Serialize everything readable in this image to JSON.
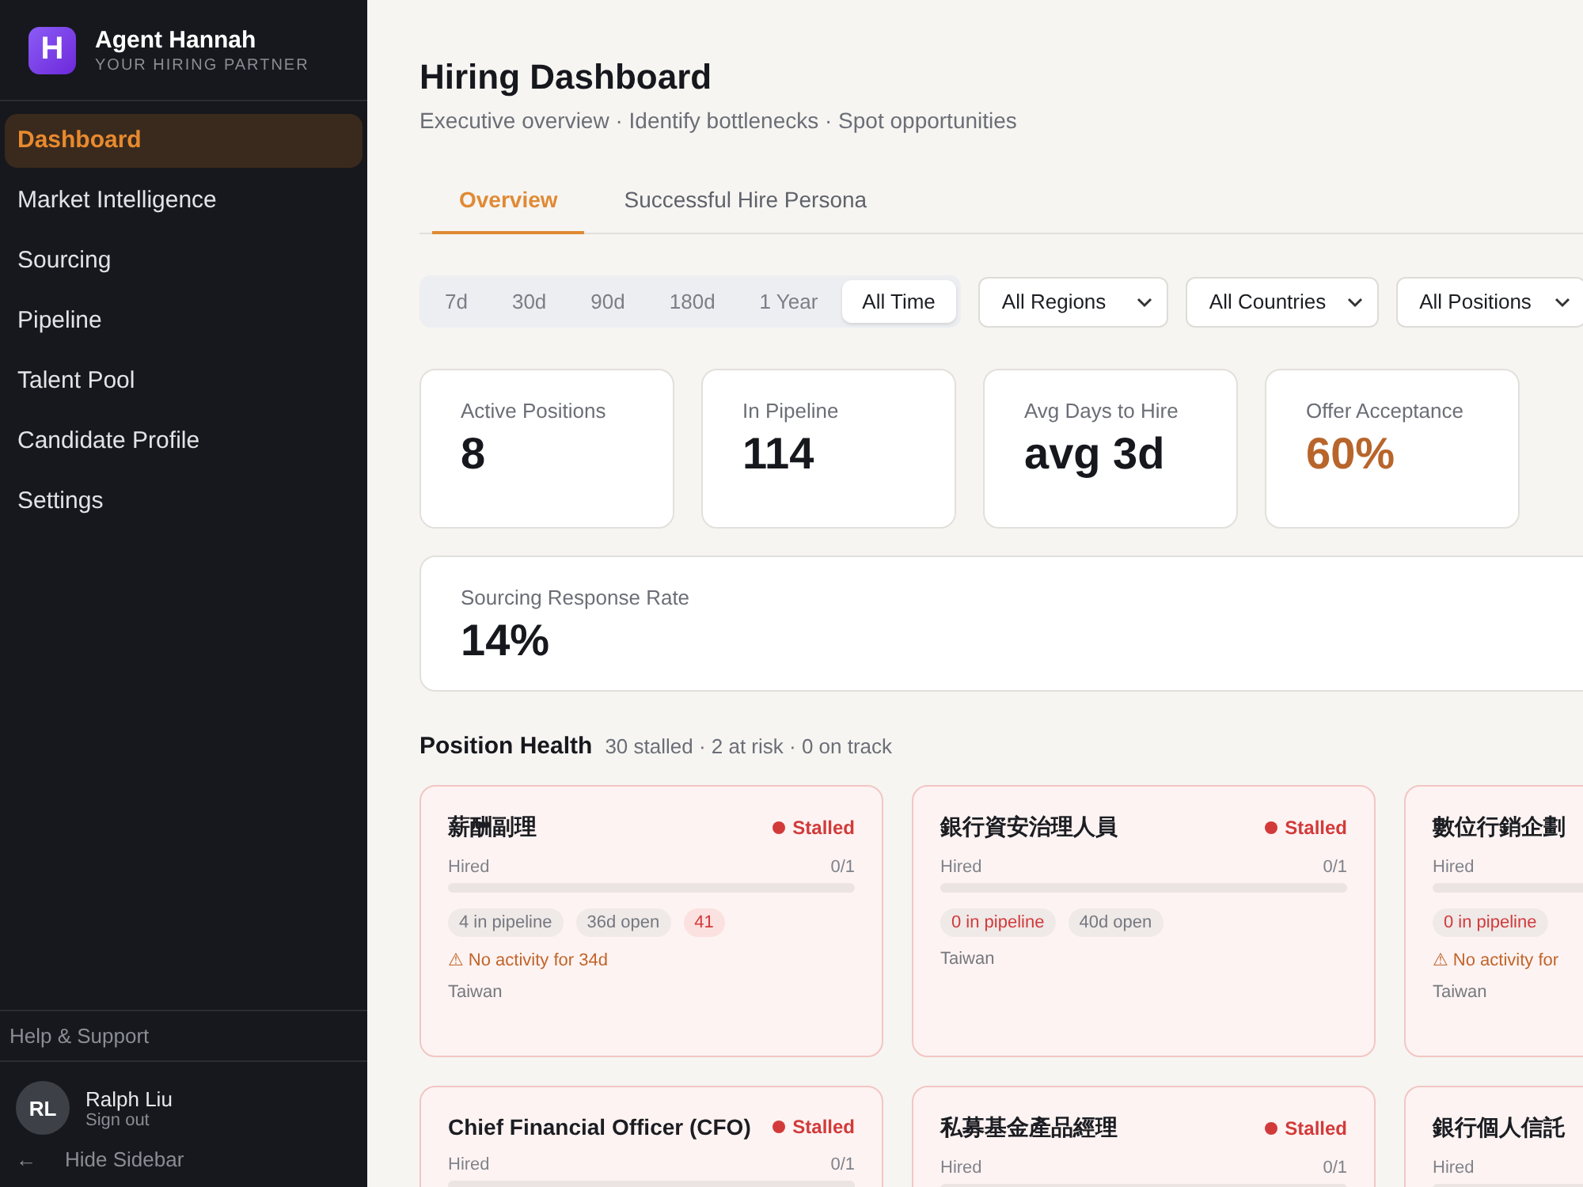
{
  "brand": {
    "logo": "H",
    "name": "Agent Hannah",
    "tagline": "YOUR HIRING PARTNER"
  },
  "nav": [
    {
      "label": "Dashboard",
      "selected": true
    },
    {
      "label": "Market Intelligence",
      "selected": false
    },
    {
      "label": "Sourcing",
      "selected": false
    },
    {
      "label": "Pipeline",
      "selected": false
    },
    {
      "label": "Talent Pool",
      "selected": false
    },
    {
      "label": "Candidate Profile",
      "selected": false
    },
    {
      "label": "Settings",
      "selected": false
    }
  ],
  "help": "Help & Support",
  "user": {
    "initials": "RL",
    "name": "Ralph Liu",
    "action": "Sign out"
  },
  "hide_sidebar": {
    "icon": "←",
    "label": "Hide Sidebar"
  },
  "page": {
    "title": "Hiring Dashboard",
    "subtitle": "Executive overview · Identify bottlenecks · Spot opportunities"
  },
  "tabs": [
    {
      "label": "Overview",
      "selected": true
    },
    {
      "label": "Successful Hire Persona",
      "selected": false
    }
  ],
  "periods": [
    {
      "label": "7d",
      "selected": false
    },
    {
      "label": "30d",
      "selected": false
    },
    {
      "label": "90d",
      "selected": false
    },
    {
      "label": "180d",
      "selected": false
    },
    {
      "label": "1 Year",
      "selected": false
    },
    {
      "label": "All Time",
      "selected": true
    }
  ],
  "filters": [
    {
      "value": "All Regions"
    },
    {
      "value": "All Countries"
    },
    {
      "value": "All Positions"
    }
  ],
  "stats": [
    {
      "label": "Active Positions",
      "value": "8",
      "highlight": false
    },
    {
      "label": "In Pipeline",
      "value": "114",
      "highlight": false
    },
    {
      "label": "Avg Days to Hire",
      "value": "avg 3d",
      "highlight": false
    },
    {
      "label": "Offer Acceptance",
      "value": "60%",
      "highlight": true
    }
  ],
  "wide_stat": {
    "label": "Sourcing Response Rate",
    "value": "14%"
  },
  "position_health": {
    "title": "Position Health",
    "summary": "30 stalled · 2 at risk · 0 on track"
  },
  "positions": [
    {
      "name": "薪酬副理",
      "status": {
        "label": "Stalled",
        "color": "#d23a3a"
      },
      "hired_label": "Hired",
      "hired": "0/1",
      "level": 0,
      "chips": [
        {
          "kind": "plain",
          "text": "4 in pipeline"
        },
        {
          "kind": "plain",
          "text": "36d open"
        },
        {
          "kind": "count",
          "text": "41"
        }
      ],
      "warning": "⚠ No activity for 34d",
      "location": "Taiwan"
    },
    {
      "name": "銀行資安治理人員",
      "status": {
        "label": "Stalled",
        "color": "#d23a3a"
      },
      "hired_label": "Hired",
      "hired": "0/1",
      "level": 0,
      "chips": [
        {
          "kind": "alert",
          "text": "0 in pipeline"
        },
        {
          "kind": "plain",
          "text": "40d open"
        }
      ],
      "location": "Taiwan"
    },
    {
      "name": "數位行銷企劃",
      "hired_label": "Hired",
      "level": 0,
      "chips": [
        {
          "kind": "alert",
          "text": "0 in pipeline"
        }
      ],
      "warning": "⚠ No activity for",
      "location": "Taiwan"
    },
    {
      "name": "Chief Financial Officer (CFO)",
      "status": {
        "label": "Stalled",
        "color": "#d23a3a"
      },
      "hired_label": "Hired",
      "hired": "0/1",
      "level": 0
    },
    {
      "name": "私募基金產品經理",
      "status": {
        "label": "Stalled",
        "color": "#d23a3a"
      },
      "hired_label": "Hired",
      "hired": "0/1",
      "level": 0
    },
    {
      "name": "銀行個人信託",
      "hired_label": "Hired",
      "level": 0
    }
  ]
}
